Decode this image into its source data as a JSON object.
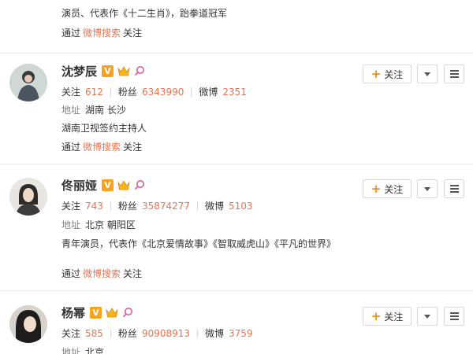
{
  "top_partial": {
    "bio": "演员、代表作《十二生肖》，跆拳道冠军",
    "via_prefix": "通过",
    "via_link": "微博搜索",
    "via_action": "关注"
  },
  "labels": {
    "follow_btn": "关注",
    "following": "关注",
    "fans": "粉丝",
    "weibo": "微博",
    "location": "地址",
    "via_prefix": "通过",
    "via_link": "微博搜索",
    "via_action": "关注"
  },
  "users": [
    {
      "name": "沈梦辰",
      "following": "612",
      "fans": "6343990",
      "weibo": "2351",
      "location": "湖南 长沙",
      "bio": "湖南卫视签约主持人"
    },
    {
      "name": "佟丽娅",
      "following": "743",
      "fans": "35874277",
      "weibo": "5103",
      "location": "北京 朝阳区",
      "bio": "青年演员，代表作《北京爱情故事》《智取威虎山》《平凡的世界》"
    },
    {
      "name": "杨幂",
      "following": "585",
      "fans": "90908913",
      "weibo": "3759",
      "location": "北京"
    }
  ],
  "icons": {
    "verified": "verified-v-icon",
    "crown": "crown-icon",
    "member": "member-icon",
    "plus": "plus-icon",
    "dropdown": "chevron-down-icon",
    "menu": "menu-icon"
  },
  "colors": {
    "accent": "#eb7350",
    "verified": "#f7a21c",
    "plus": "#f28c1c",
    "member": "#d6609a"
  }
}
